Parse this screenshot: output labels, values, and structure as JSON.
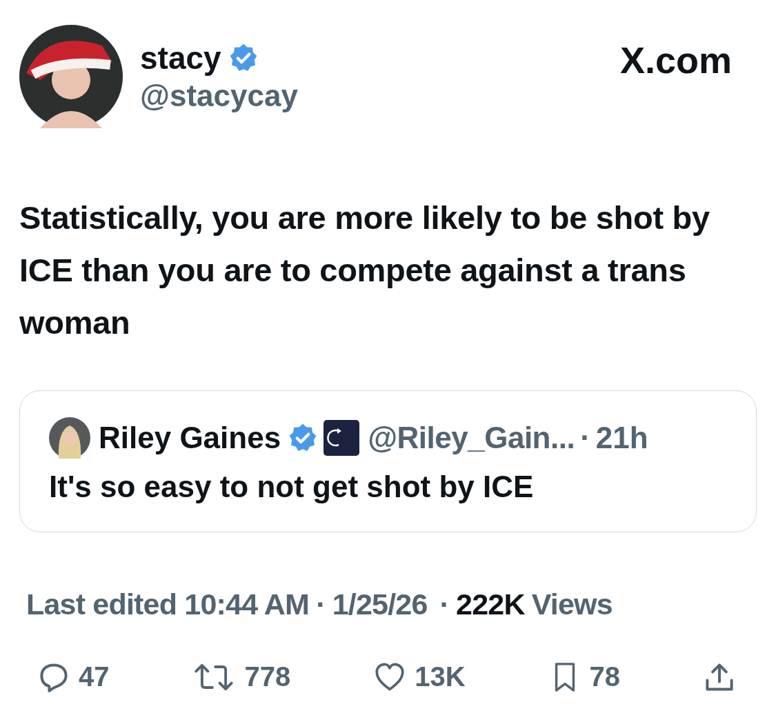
{
  "author": {
    "name": "stacy",
    "handle": "@stacycay",
    "verified": true
  },
  "site": "X.com",
  "text": "Statistically, you are more likely to be shot by ICE than you are to compete against a trans woman",
  "quote": {
    "name": "Riley Gaines",
    "verified": true,
    "handle": "@Riley_Gain...",
    "separator": "·",
    "time": "21h",
    "text": "It's so easy to not get shot by ICE"
  },
  "meta": {
    "edited": "Last edited 10:44 AM",
    "separator_1": "·",
    "date": "1/25/26",
    "separator_2": "·",
    "views_count": "222K",
    "views_label": "Views"
  },
  "actions": [
    {
      "kind": "reply",
      "count": "47"
    },
    {
      "kind": "repost",
      "count": "778"
    },
    {
      "kind": "like",
      "count": "13K"
    },
    {
      "kind": "bookmark",
      "count": "78"
    },
    {
      "kind": "share"
    }
  ]
}
